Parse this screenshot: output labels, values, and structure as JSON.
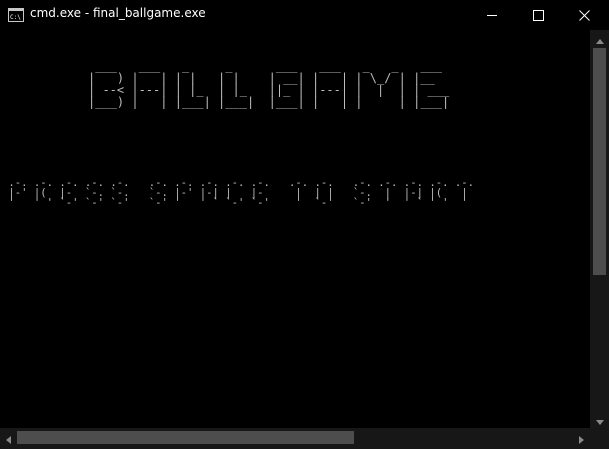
{
  "window": {
    "title": "cmd.exe - final_ballgame.exe",
    "icon": "cmd-icon",
    "controls": {
      "minimize_icon": "minimize-icon",
      "maximize_icon": "maximize-icon",
      "close_icon": "close-icon"
    }
  },
  "console": {
    "title_art": " ___   ___   _     _      ___   ___   _   _   ___ \n|   ) |   | | |   | |    | __| |   | | \\_/ | |__  \n| --< |---| | |_  | |_   ||_ | |---| |  |  | | ___\n|___) |   | |___| |___|  |___| |   | |     | |___|",
    "prompt_art": " .-. .-. .-. .-. .-.   .-. .-. .-. .-. .-.   .-. .-.   .-. .-. .-. .-. .-.\n |-' |(  |-  `-. `-.   `-. |-' |-| |   |-     |  | |   `-.  |  |-| |(   | \n '   ' ' `-' `-' `-'   `-' '   ' ` `-' `-'    '  `-'   `-'  '  ' ` ' '  ' "
  },
  "colors": {
    "background": "#000000",
    "text": "#bdbdbd",
    "titlebar_text": "#ffffff",
    "scrollbar_track": "#171717",
    "scrollbar_thumb": "#4d4d4d"
  }
}
